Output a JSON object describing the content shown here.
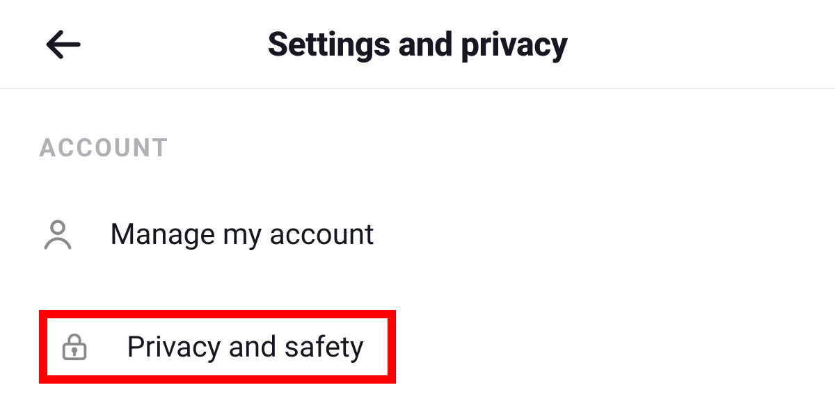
{
  "header": {
    "title": "Settings and privacy"
  },
  "section": {
    "heading": "ACCOUNT",
    "items": [
      {
        "label": "Manage my account"
      },
      {
        "label": "Privacy and safety"
      }
    ]
  }
}
